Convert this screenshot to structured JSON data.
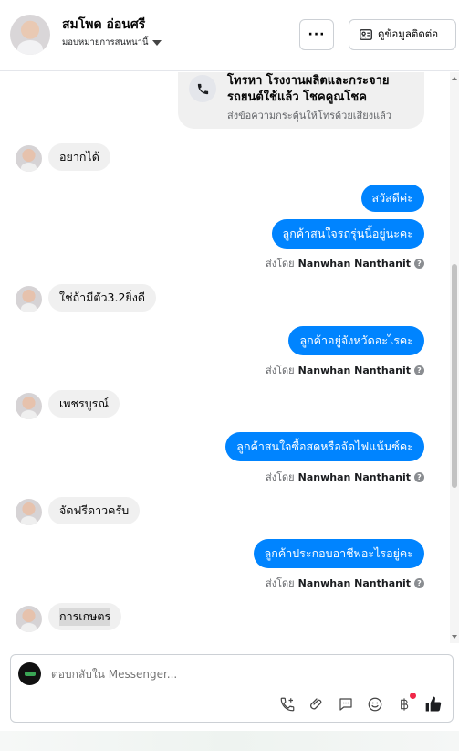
{
  "header": {
    "contact_name": "สมโพด อ่อนศรี",
    "assign_label": "มอบหมายการสนทนานี้",
    "more_label": "···",
    "info_button_label": "ดูข้อมูลติดต่อ"
  },
  "call_card": {
    "title": "โทรหา โรงงานผลิตและกระจายรถยนต์ใช้แล้ว โชคคูณโชค",
    "subtitle": "ส่งข้อความกระตุ้นให้โทรด้วยเสียงแล้ว"
  },
  "messages": [
    {
      "dir": "in",
      "text": "อยากได้"
    },
    {
      "dir": "out",
      "text": "สวัสดีค่ะ"
    },
    {
      "dir": "out",
      "text": "ลูกค้าสนใจรถรุ่นนี้อยู่นะคะ",
      "sent_by_prefix": "ส่งโดย",
      "sent_by_name": "Nanwhan Nanthanit"
    },
    {
      "dir": "in",
      "text": "ใช่ถ้ามีตัว3.2ยิ่งดี"
    },
    {
      "dir": "out",
      "text": "ลูกค้าอยู่จังหวัดอะไรคะ",
      "sent_by_prefix": "ส่งโดย",
      "sent_by_name": "Nanwhan Nanthanit"
    },
    {
      "dir": "in",
      "text": "เพชรบูรณ์"
    },
    {
      "dir": "out",
      "text": "ลูกค้าสนใจซื้อสดหรือจัดไฟแน้นซ์คะ",
      "sent_by_prefix": "ส่งโดย",
      "sent_by_name": "Nanwhan Nanthanit"
    },
    {
      "dir": "in",
      "text": "จัดฟรีดาวครับ"
    },
    {
      "dir": "out",
      "text": "ลูกค้าประกอบอาชีพอะไรอยู่คะ",
      "sent_by_prefix": "ส่งโดย",
      "sent_by_name": "Nanwhan Nanthanit"
    },
    {
      "dir": "in",
      "text": "การเกษตร"
    }
  ],
  "composer": {
    "placeholder": "ตอบกลับใน Messenger...",
    "tools": [
      "phone-plus-icon",
      "paperclip-icon",
      "saved-reply-icon",
      "emoji-icon",
      "baht-icon",
      "thumbs-up-icon"
    ]
  },
  "colors": {
    "outgoing_bubble": "#0084ff",
    "incoming_bubble": "#f0f0f0",
    "like": "#1c1e21",
    "notification_dot": "#f02849"
  }
}
